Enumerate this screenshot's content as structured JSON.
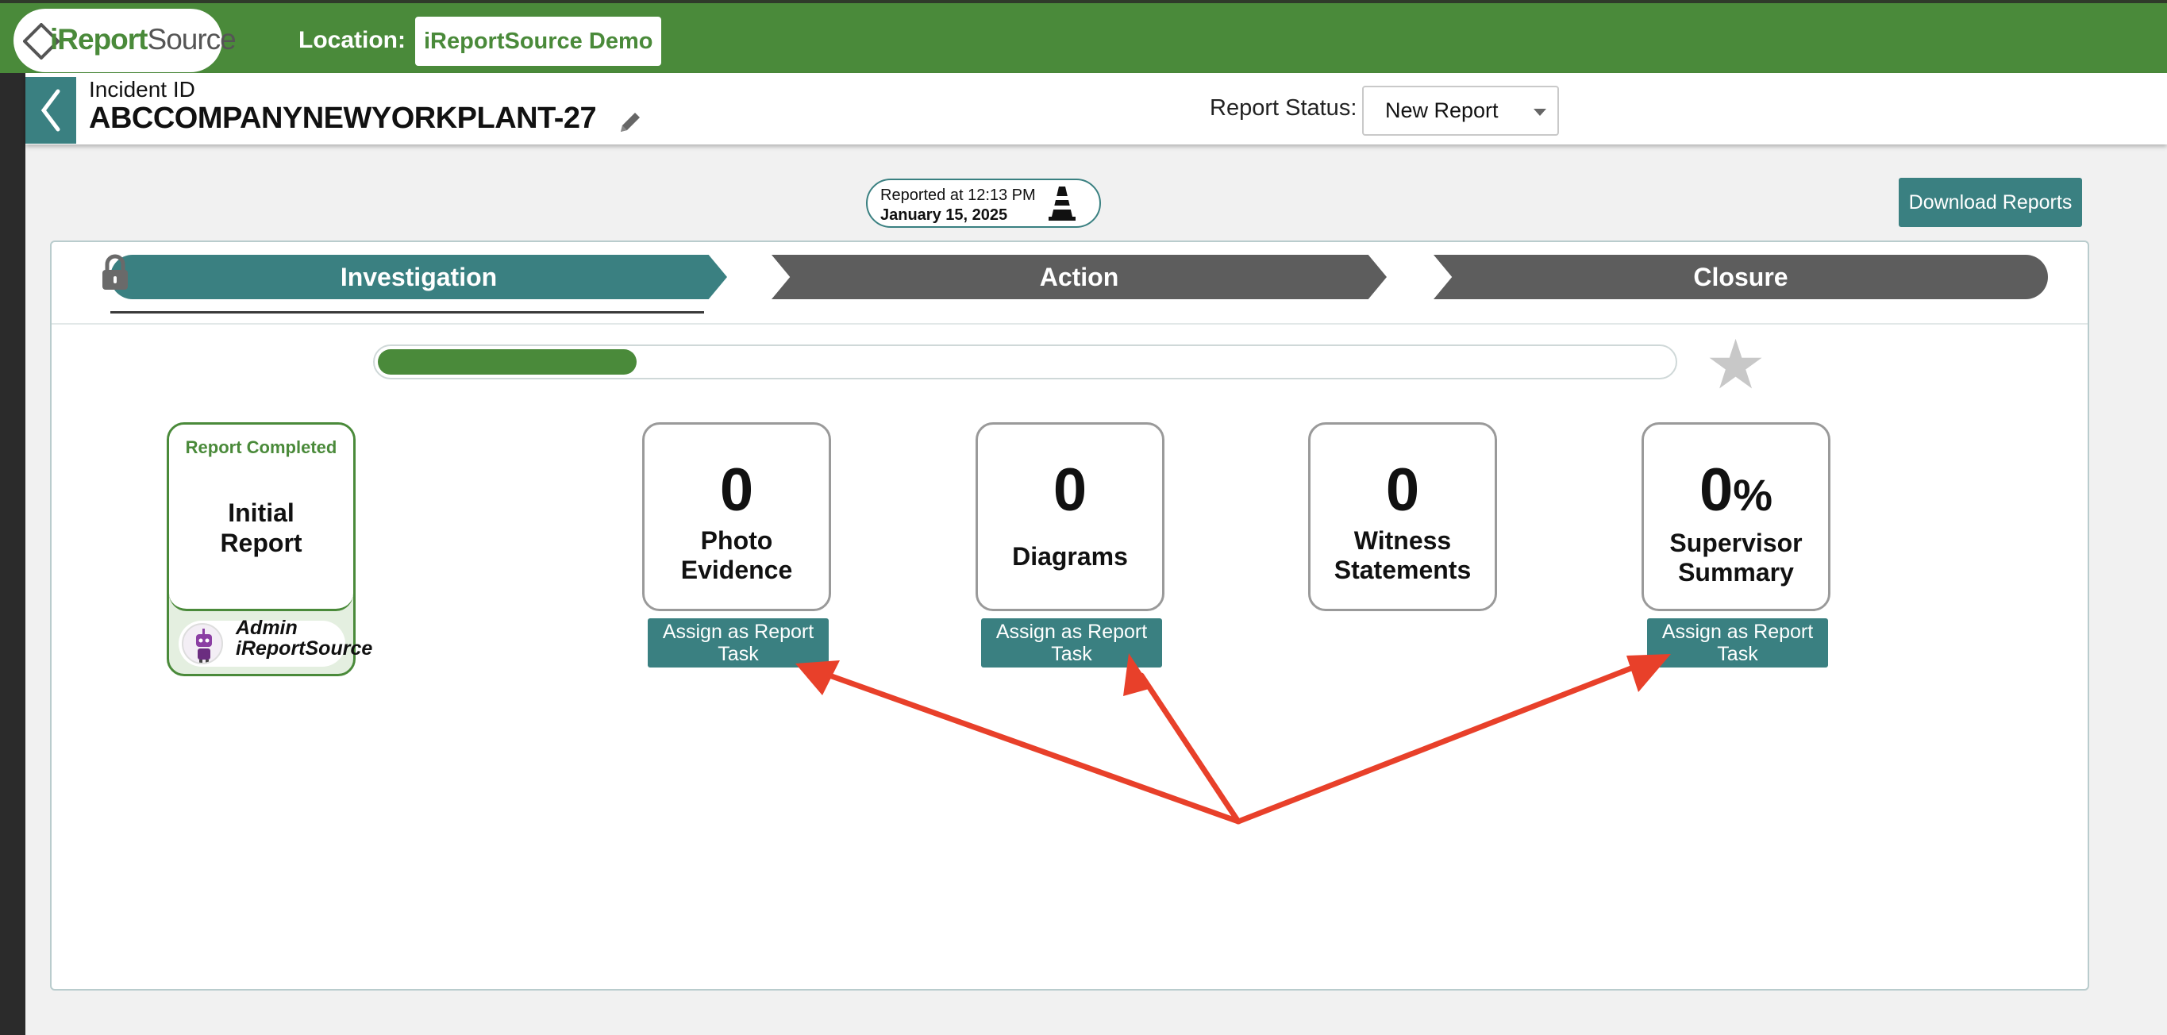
{
  "topbar": {
    "logo_text": "iReportSource",
    "location_label": "Location:",
    "location_value": "iReportSource Demo"
  },
  "header": {
    "incident_label": "Incident ID",
    "incident_id": "ABCCOMPANYNEWYORKPLANT-27",
    "status_label": "Report Status:",
    "status_value": "New Report"
  },
  "reported": {
    "time": "Reported at 12:13 PM",
    "date": "January 15, 2025"
  },
  "download_label": "Download Reports",
  "steps": [
    {
      "label": "Investigation",
      "active": true
    },
    {
      "label": "Action",
      "active": false
    },
    {
      "label": "Closure",
      "active": false
    }
  ],
  "progress": {
    "fraction": 0.2
  },
  "initial_report": {
    "status": "Report Completed",
    "title_line1": "Initial",
    "title_line2": "Report",
    "user_line1": "Admin",
    "user_line2": "iReportSource"
  },
  "metrics": [
    {
      "count": "0",
      "suffix": "",
      "line1": "Photo",
      "line2": "Evidence",
      "assign": "Assign as Report Task"
    },
    {
      "count": "0",
      "suffix": "",
      "line1": "Diagrams",
      "line2": "",
      "assign": "Assign as Report Task"
    },
    {
      "count": "0",
      "suffix": "",
      "line1": "Witness",
      "line2": "Statements",
      "assign": ""
    },
    {
      "count": "0",
      "suffix": "%",
      "line1": "Supervisor",
      "line2": "Summary",
      "assign": "Assign as Report Task"
    }
  ],
  "colors": {
    "brand_green": "#4a8a3a",
    "teal": "#3a8081",
    "step_inactive": "#5d5d5d",
    "annotation_red": "#e8402a"
  }
}
